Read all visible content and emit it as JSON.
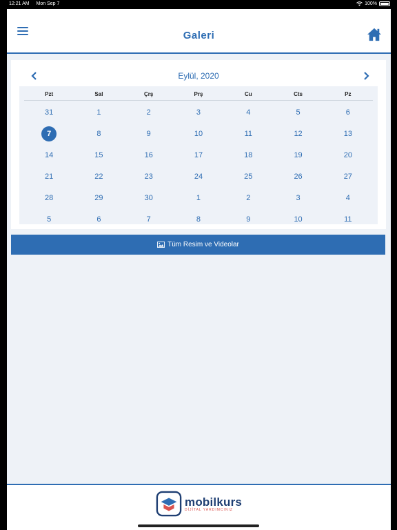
{
  "status": {
    "time": "12:21 AM",
    "date": "Mon Sep 7",
    "battery": "100%"
  },
  "header": {
    "title": "Galeri",
    "menu_icon": "hamburger-icon",
    "home_icon": "home-icon"
  },
  "calendar": {
    "month_label": "Eylül, 2020",
    "weekdays": [
      "Pzt",
      "Sal",
      "Çrş",
      "Prş",
      "Cu",
      "Cts",
      "Pz"
    ],
    "days": [
      "31",
      "1",
      "2",
      "3",
      "4",
      "5",
      "6",
      "7",
      "8",
      "9",
      "10",
      "11",
      "12",
      "13",
      "14",
      "15",
      "16",
      "17",
      "18",
      "19",
      "20",
      "21",
      "22",
      "23",
      "24",
      "25",
      "26",
      "27",
      "28",
      "29",
      "30",
      "1",
      "2",
      "3",
      "4",
      "5",
      "6",
      "7",
      "8",
      "9",
      "10",
      "11"
    ],
    "selected_index": 7
  },
  "gallery_button": {
    "label": "Tüm Resim ve Videolar",
    "icon": "image-icon"
  },
  "footer": {
    "brand": "mobilkurs",
    "tagline": "DİJİTAL YARDIMCINIZ"
  },
  "colors": {
    "accent": "#2e6db3",
    "background": "#eef2f7"
  }
}
